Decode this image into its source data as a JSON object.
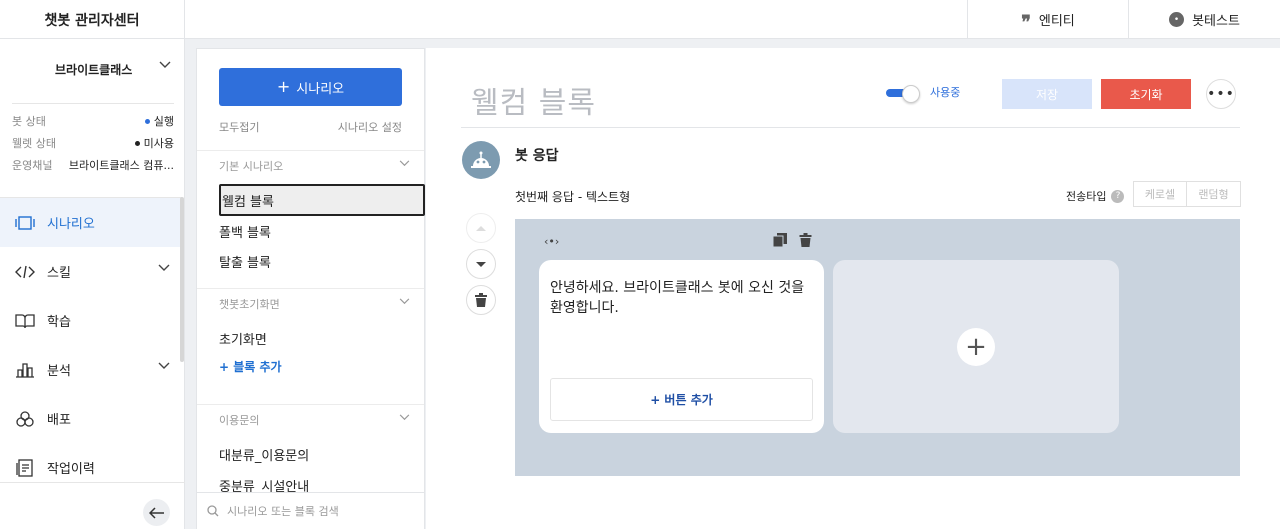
{
  "app": {
    "title": "챗봇 관리자센터"
  },
  "topbar": {
    "entity_label": "엔티티",
    "bottest_label": "봇테스트"
  },
  "sidebar": {
    "workspace": "브라이트클래스",
    "info": [
      {
        "key": "봇 상태",
        "value": "실행",
        "dot_color": "#2f6fdb"
      },
      {
        "key": "웰렛 상태",
        "value": "미사용",
        "dot_color": "#222222"
      },
      {
        "key": "운영채널",
        "value": "브라이트클래스 컴퓨..."
      }
    ],
    "nav": [
      {
        "label": "시나리오",
        "icon": "scenario-icon",
        "active": true
      },
      {
        "label": "스킬",
        "icon": "code-icon",
        "expandable": true
      },
      {
        "label": "학습",
        "icon": "book-icon"
      },
      {
        "label": "분석",
        "icon": "chart-icon",
        "expandable": true
      },
      {
        "label": "배포",
        "icon": "deploy-icon"
      },
      {
        "label": "작업이력",
        "icon": "history-icon"
      }
    ]
  },
  "panel": {
    "add_scenario_label": "시나리오",
    "collapse_all": "모두접기",
    "scenario_settings": "시나리오 설정",
    "groups": [
      {
        "title": "기본 시나리오",
        "blocks": [
          "웰컴 블록",
          "폴백 블록",
          "탈출 블록"
        ]
      },
      {
        "title": "챗봇초기화면",
        "blocks": [
          "초기화면"
        ],
        "add_label": "+ 블록 추가"
      },
      {
        "title": "이용문의",
        "blocks": [
          "대분류_이용문의",
          "중분류_시설안내"
        ]
      }
    ],
    "search_placeholder": "시나리오 또는 블록 검색"
  },
  "editor": {
    "title": "웰컴 블록",
    "toggle_label": "사용중",
    "toggle_on": true,
    "save_label": "저장",
    "reset_label": "초기화",
    "more_label": "•••",
    "bot_response_label": "봇 응답",
    "response_type_label": "첫번째 응답 - 텍스트형",
    "send_type_label": "전송타입",
    "send_types": [
      "케로셀",
      "랜덤형"
    ],
    "card": {
      "text": "안녕하세요. 브라이트클래스 봇에 오신 것을 환영합니다.",
      "add_button_label": "+ 버튼 추가"
    }
  },
  "colors": {
    "accent": "#2f6fdb",
    "danger": "#e9594b",
    "canvas_bg": "#c9d3de"
  }
}
